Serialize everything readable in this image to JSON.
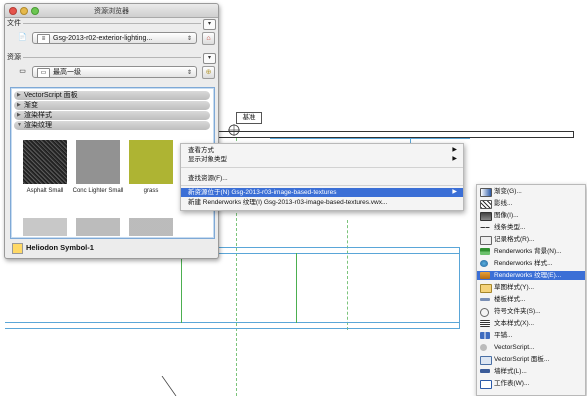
{
  "palette": {
    "title": "资源浏览器",
    "file_label": "文件",
    "file_name": "Gsg-2013-r02-exterior-lighting...",
    "resource_label": "资源",
    "level": "最高一级",
    "categories": [
      {
        "label": "VectorScript 面板",
        "expanded": false
      },
      {
        "label": "渐变",
        "expanded": false
      },
      {
        "label": "渲染样式",
        "expanded": false
      },
      {
        "label": "渲染纹理",
        "expanded": true
      }
    ],
    "thumbnails": [
      {
        "label": "Asphalt Small"
      },
      {
        "label": "Conc Lighter Small"
      },
      {
        "label": "grass"
      }
    ],
    "selected_resource": "Heliodon Symbol-1",
    "colors": {
      "selection_border": "#7fa9d6"
    }
  },
  "canvas": {
    "tag_label": "基准"
  },
  "context_menu": {
    "items": [
      {
        "label": "查看方式",
        "submenu": true
      },
      {
        "label": "显示对象类型",
        "submenu": true
      },
      {
        "label": "查找资源(F)...",
        "submenu": false
      },
      {
        "label": "新资源位于(N) Gsg-2013-r03-image-based-textures",
        "submenu": true,
        "selected": true
      },
      {
        "label": "新建 Renderworks 纹理(I) Gsg-2013-r03-image-based-textures.vwx...",
        "submenu": false
      }
    ],
    "selection_color": "#3b6fd6"
  },
  "submenu": {
    "items": [
      {
        "label": "渐变(G)...",
        "icon": "gradient-icon"
      },
      {
        "label": "影线...",
        "icon": "hatch-icon"
      },
      {
        "label": "图像(I)...",
        "icon": "image-icon"
      },
      {
        "label": "线条类型...",
        "icon": "line-type-icon"
      },
      {
        "label": "记录格式(R)...",
        "icon": "record-format-icon"
      },
      {
        "label": "Renderworks 背景(N)...",
        "icon": "background-icon"
      },
      {
        "label": "Renderworks 样式...",
        "icon": "style-icon"
      },
      {
        "label": "Renderworks 纹理(E)...",
        "icon": "texture-icon",
        "selected": true
      },
      {
        "label": "草图样式(Y)...",
        "icon": "sketch-icon"
      },
      {
        "label": "楼板样式...",
        "icon": "slab-icon"
      },
      {
        "label": "符号文件夹(S)...",
        "icon": "symbol-folder-icon"
      },
      {
        "label": "文本样式(X)...",
        "icon": "text-style-icon"
      },
      {
        "label": "平铺...",
        "icon": "tile-icon"
      },
      {
        "label": "VectorScript...",
        "icon": "script-icon"
      },
      {
        "label": "VectorScript 面板...",
        "icon": "script-palette-icon"
      },
      {
        "label": "墙样式(L)...",
        "icon": "wall-style-icon"
      },
      {
        "label": "工作表(W)...",
        "icon": "worksheet-icon"
      }
    ]
  }
}
